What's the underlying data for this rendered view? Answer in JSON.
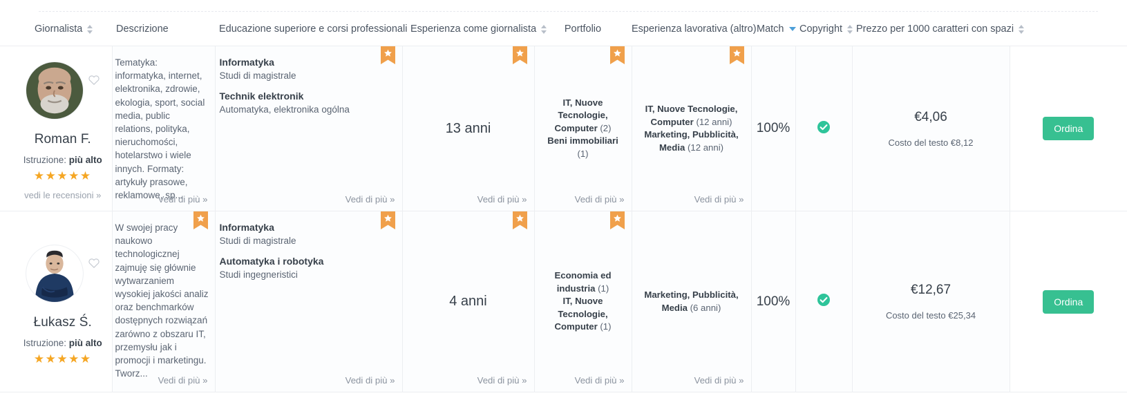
{
  "colors": {
    "accent_orange": "#f5a623",
    "badge_orange": "#f0a04b",
    "order_green": "#37c091",
    "check_green": "#2ec49a",
    "text_dark": "#37404a",
    "text_muted": "#5a6472",
    "link_muted": "#8b939f",
    "border": "#eceef1",
    "caret_blue": "#4e9fd8"
  },
  "table": {
    "headers": [
      {
        "label": "Giornalista",
        "sortable": true,
        "dropdown": false,
        "icon": "sort-icon"
      },
      {
        "label": "Descrizione",
        "sortable": false,
        "dropdown": false,
        "icon": ""
      },
      {
        "label": "Educazione superiore e corsi professionali",
        "sortable": false,
        "dropdown": false,
        "icon": ""
      },
      {
        "label": "Esperienza come giornalista",
        "sortable": true,
        "dropdown": false,
        "icon": "sort-icon"
      },
      {
        "label": "Portfolio",
        "sortable": false,
        "dropdown": false,
        "icon": ""
      },
      {
        "label": "Esperienza lavorativa (altro)",
        "sortable": false,
        "dropdown": false,
        "icon": ""
      },
      {
        "label": "Match",
        "sortable": false,
        "dropdown": true,
        "icon": "chevron-down-icon"
      },
      {
        "label": "Copyright",
        "sortable": true,
        "dropdown": false,
        "icon": "sort-icon"
      },
      {
        "label": "Prezzo per 1000 caratteri con spazi",
        "sortable": true,
        "dropdown": false,
        "icon": "sort-icon"
      }
    ],
    "more_link_label": "Vedi di più »",
    "reviews_link_label": "vedi le recensioni »",
    "education_label_prefix": "Istruzione:",
    "order_button_label": "Ordina",
    "cost_prefix": "Costo del testo",
    "stars_glyphs": "★★★★★",
    "rows": [
      {
        "name": "Roman F.",
        "avatar_icon": "avatar-photo",
        "favorite_icon": "heart-outline-icon",
        "education_level": "più alto",
        "rating_stars": 5,
        "description": "Tematyka: informatyka, internet, elektronika, zdrowie, ekologia, sport, social media, public relations, polityka, nieruchomości, hotelarstwo i wiele innych. Formaty: artykuły prasowe, reklamowe, sp...",
        "education": [
          {
            "title": "Informatyka",
            "subtitle": "Studi di magistrale"
          },
          {
            "title": "Technik elektronik",
            "subtitle": "Automatyka, elektronika ogólna"
          }
        ],
        "education_badge": true,
        "journalist_experience": "13 anni",
        "journalist_experience_badge": true,
        "portfolio": [
          {
            "label": "IT, Nuove Tecnologie, Computer",
            "count": "(2)"
          },
          {
            "label": "Beni immobiliari",
            "count": "(1)"
          }
        ],
        "portfolio_badge": true,
        "work_experience": [
          {
            "label": "IT, Nuove Tecnologie, Computer",
            "count": "(12 anni)"
          },
          {
            "label": "Marketing, Pubblicità, Media",
            "count": "(12 anni)"
          }
        ],
        "work_experience_badge": true,
        "match": "100%",
        "copyright_icon": "check-circle-icon",
        "price": "€4,06",
        "text_cost": "€8,12",
        "description_badge": false
      },
      {
        "name": "Łukasz Ś.",
        "avatar_icon": "avatar-photo",
        "favorite_icon": "heart-outline-icon",
        "education_level": "più alto",
        "rating_stars": 5,
        "description": "W swojej pracy naukowo technologicznej zajmuję się głównie wytwarzaniem wysokiej jakości analiz oraz benchmarków dostępnych rozwiązań zarówno z obszaru IT, przemysłu jak i promocji i marketingu. Tworz...",
        "education": [
          {
            "title": "Informatyka",
            "subtitle": "Studi di magistrale"
          },
          {
            "title": "Automatyka i robotyka",
            "subtitle": "Studi ingegneristici"
          }
        ],
        "education_badge": true,
        "journalist_experience": "4 anni",
        "journalist_experience_badge": true,
        "portfolio": [
          {
            "label": "Economia ed industria",
            "count": "(1)"
          },
          {
            "label": "IT, Nuove Tecnologie, Computer",
            "count": "(1)"
          }
        ],
        "portfolio_badge": true,
        "work_experience": [
          {
            "label": "Marketing, Pubblicità, Media",
            "count": "(6 anni)"
          }
        ],
        "work_experience_badge": false,
        "match": "100%",
        "copyright_icon": "check-circle-icon",
        "price": "€12,67",
        "text_cost": "€25,34",
        "description_badge": true
      }
    ]
  }
}
